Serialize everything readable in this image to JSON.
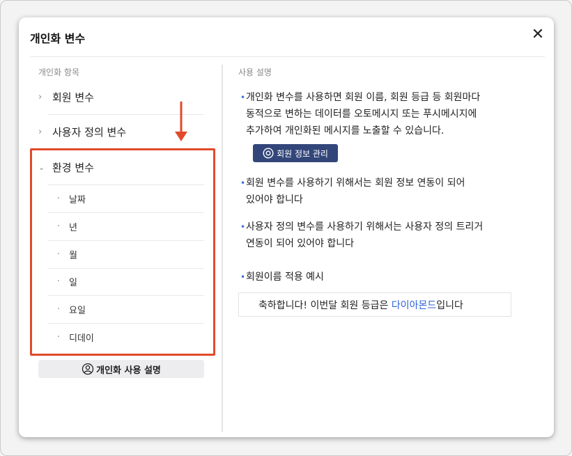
{
  "modal": {
    "title": "개인화 변수",
    "close_icon": "close-icon"
  },
  "left": {
    "section_label": "개인화 항목",
    "items": [
      {
        "label": "회원 변수",
        "expanded": false,
        "icon": "chevron-right-icon"
      },
      {
        "label": "사용자 정의 변수",
        "expanded": false,
        "icon": "chevron-right-icon"
      },
      {
        "label": "환경 변수",
        "expanded": true,
        "icon": "chevron-down-icon"
      }
    ],
    "sub_items": [
      {
        "bullet": "·",
        "label": "날짜"
      },
      {
        "bullet": "·",
        "label": "년"
      },
      {
        "bullet": "·",
        "label": "월"
      },
      {
        "bullet": "·",
        "label": "일"
      },
      {
        "bullet": "·",
        "label": "요일"
      },
      {
        "bullet": "·",
        "label": "디데이"
      }
    ],
    "guide_button": {
      "label": "개인화 사용 설명",
      "icon": "user-circle-icon"
    },
    "annotation": {
      "color": "#e14a2b",
      "arrow_icon": "arrow-down-icon"
    }
  },
  "right": {
    "section_label": "사용 설명",
    "bullet_char": "•",
    "paragraph1": [
      "개인화 변수를 사용하면 회원 이름, 회원 등급 등 회원마다",
      "동적으로 변하는 데이터를 오토메시지 또는 푸시메시지에",
      "추가하여 개인화된 메시지를 노출할 수 있습니다."
    ],
    "member_button": {
      "label": "회원 정보 관리",
      "icon": "eye-icon"
    },
    "paragraph2": [
      "회원 변수를 사용하기 위해서는 회원 정보 연동이 되어",
      "있어야 합니다"
    ],
    "paragraph3": [
      "사용자 정의 변수를 사용하기 위해서는 사용자 정의 트리거",
      "연동이 되어 있어야 합니다"
    ],
    "paragraph4": "회원이름 적용 예시",
    "example": {
      "before": "축하합니다! 이번달 회원 등급은 ",
      "highlight": "다이아몬드",
      "after": "입니다"
    }
  },
  "colors": {
    "accent": "#3b6fd8",
    "button_dark": "#33467a",
    "highlight_text": "#2c63d6"
  }
}
